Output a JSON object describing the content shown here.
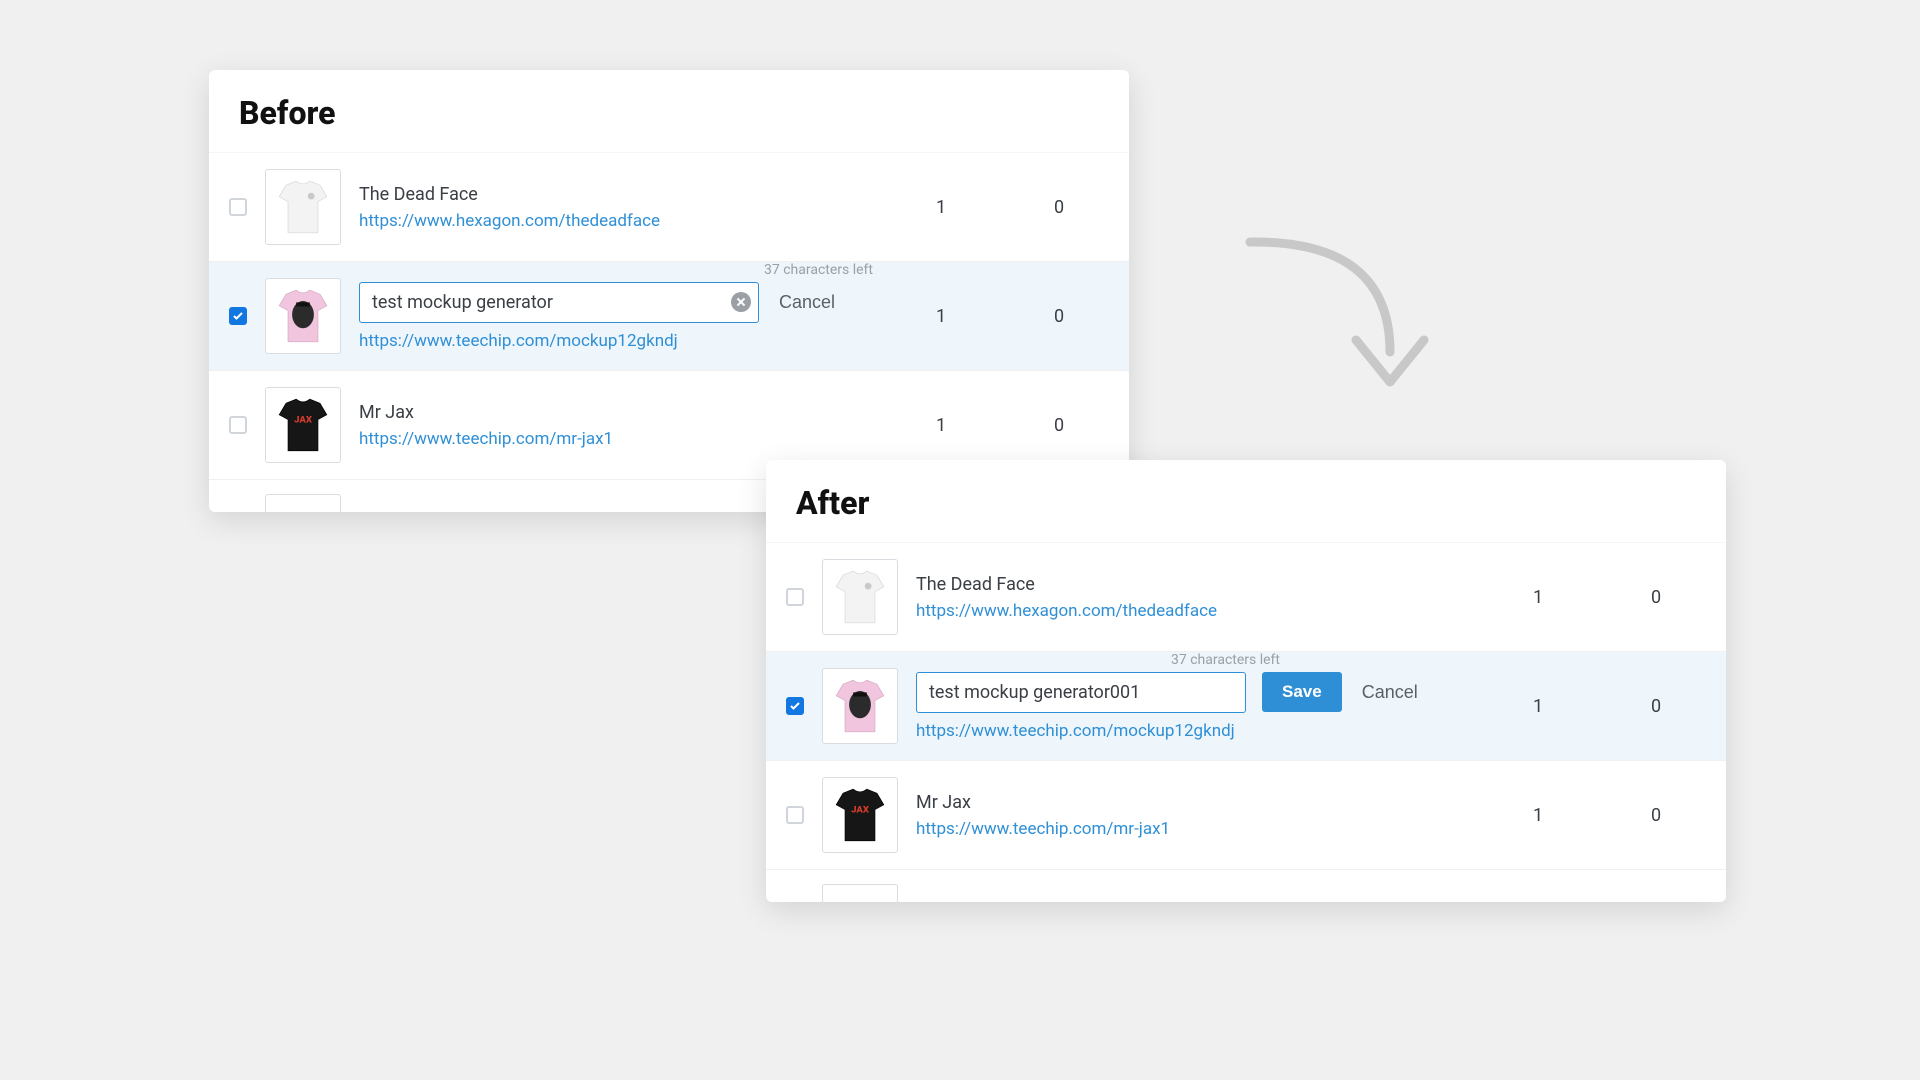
{
  "before": {
    "title": "Before",
    "rows": [
      {
        "name": "The Dead Face",
        "url": "https://www.hexagon.com/thedeadface",
        "col1": "1",
        "col2": "0",
        "checked": false,
        "shirt": "white"
      },
      {
        "editing": true,
        "chars_left": "37 characters left",
        "value": "test mockup generator",
        "cancel": "Cancel",
        "url": "https://www.teechip.com/mockup12gkndj",
        "col1": "1",
        "col2": "0",
        "checked": true,
        "shirt": "pink"
      },
      {
        "name": "Mr Jax",
        "url": "https://www.teechip.com/mr-jax1",
        "col1": "1",
        "col2": "0",
        "checked": false,
        "shirt": "black"
      }
    ]
  },
  "after": {
    "title": "After",
    "rows": [
      {
        "name": "The Dead Face",
        "url": "https://www.hexagon.com/thedeadface",
        "col1": "1",
        "col2": "0",
        "checked": false,
        "shirt": "white"
      },
      {
        "editing": true,
        "chars_left": "37 characters left",
        "value": "test mockup generator001",
        "save": "Save",
        "cancel": "Cancel",
        "url": "https://www.teechip.com/mockup12gkndj",
        "col1": "1",
        "col2": "0",
        "checked": true,
        "shirt": "pink"
      },
      {
        "name": "Mr Jax",
        "url": "https://www.teechip.com/mr-jax1",
        "col1": "1",
        "col2": "0",
        "checked": false,
        "shirt": "black"
      }
    ]
  }
}
